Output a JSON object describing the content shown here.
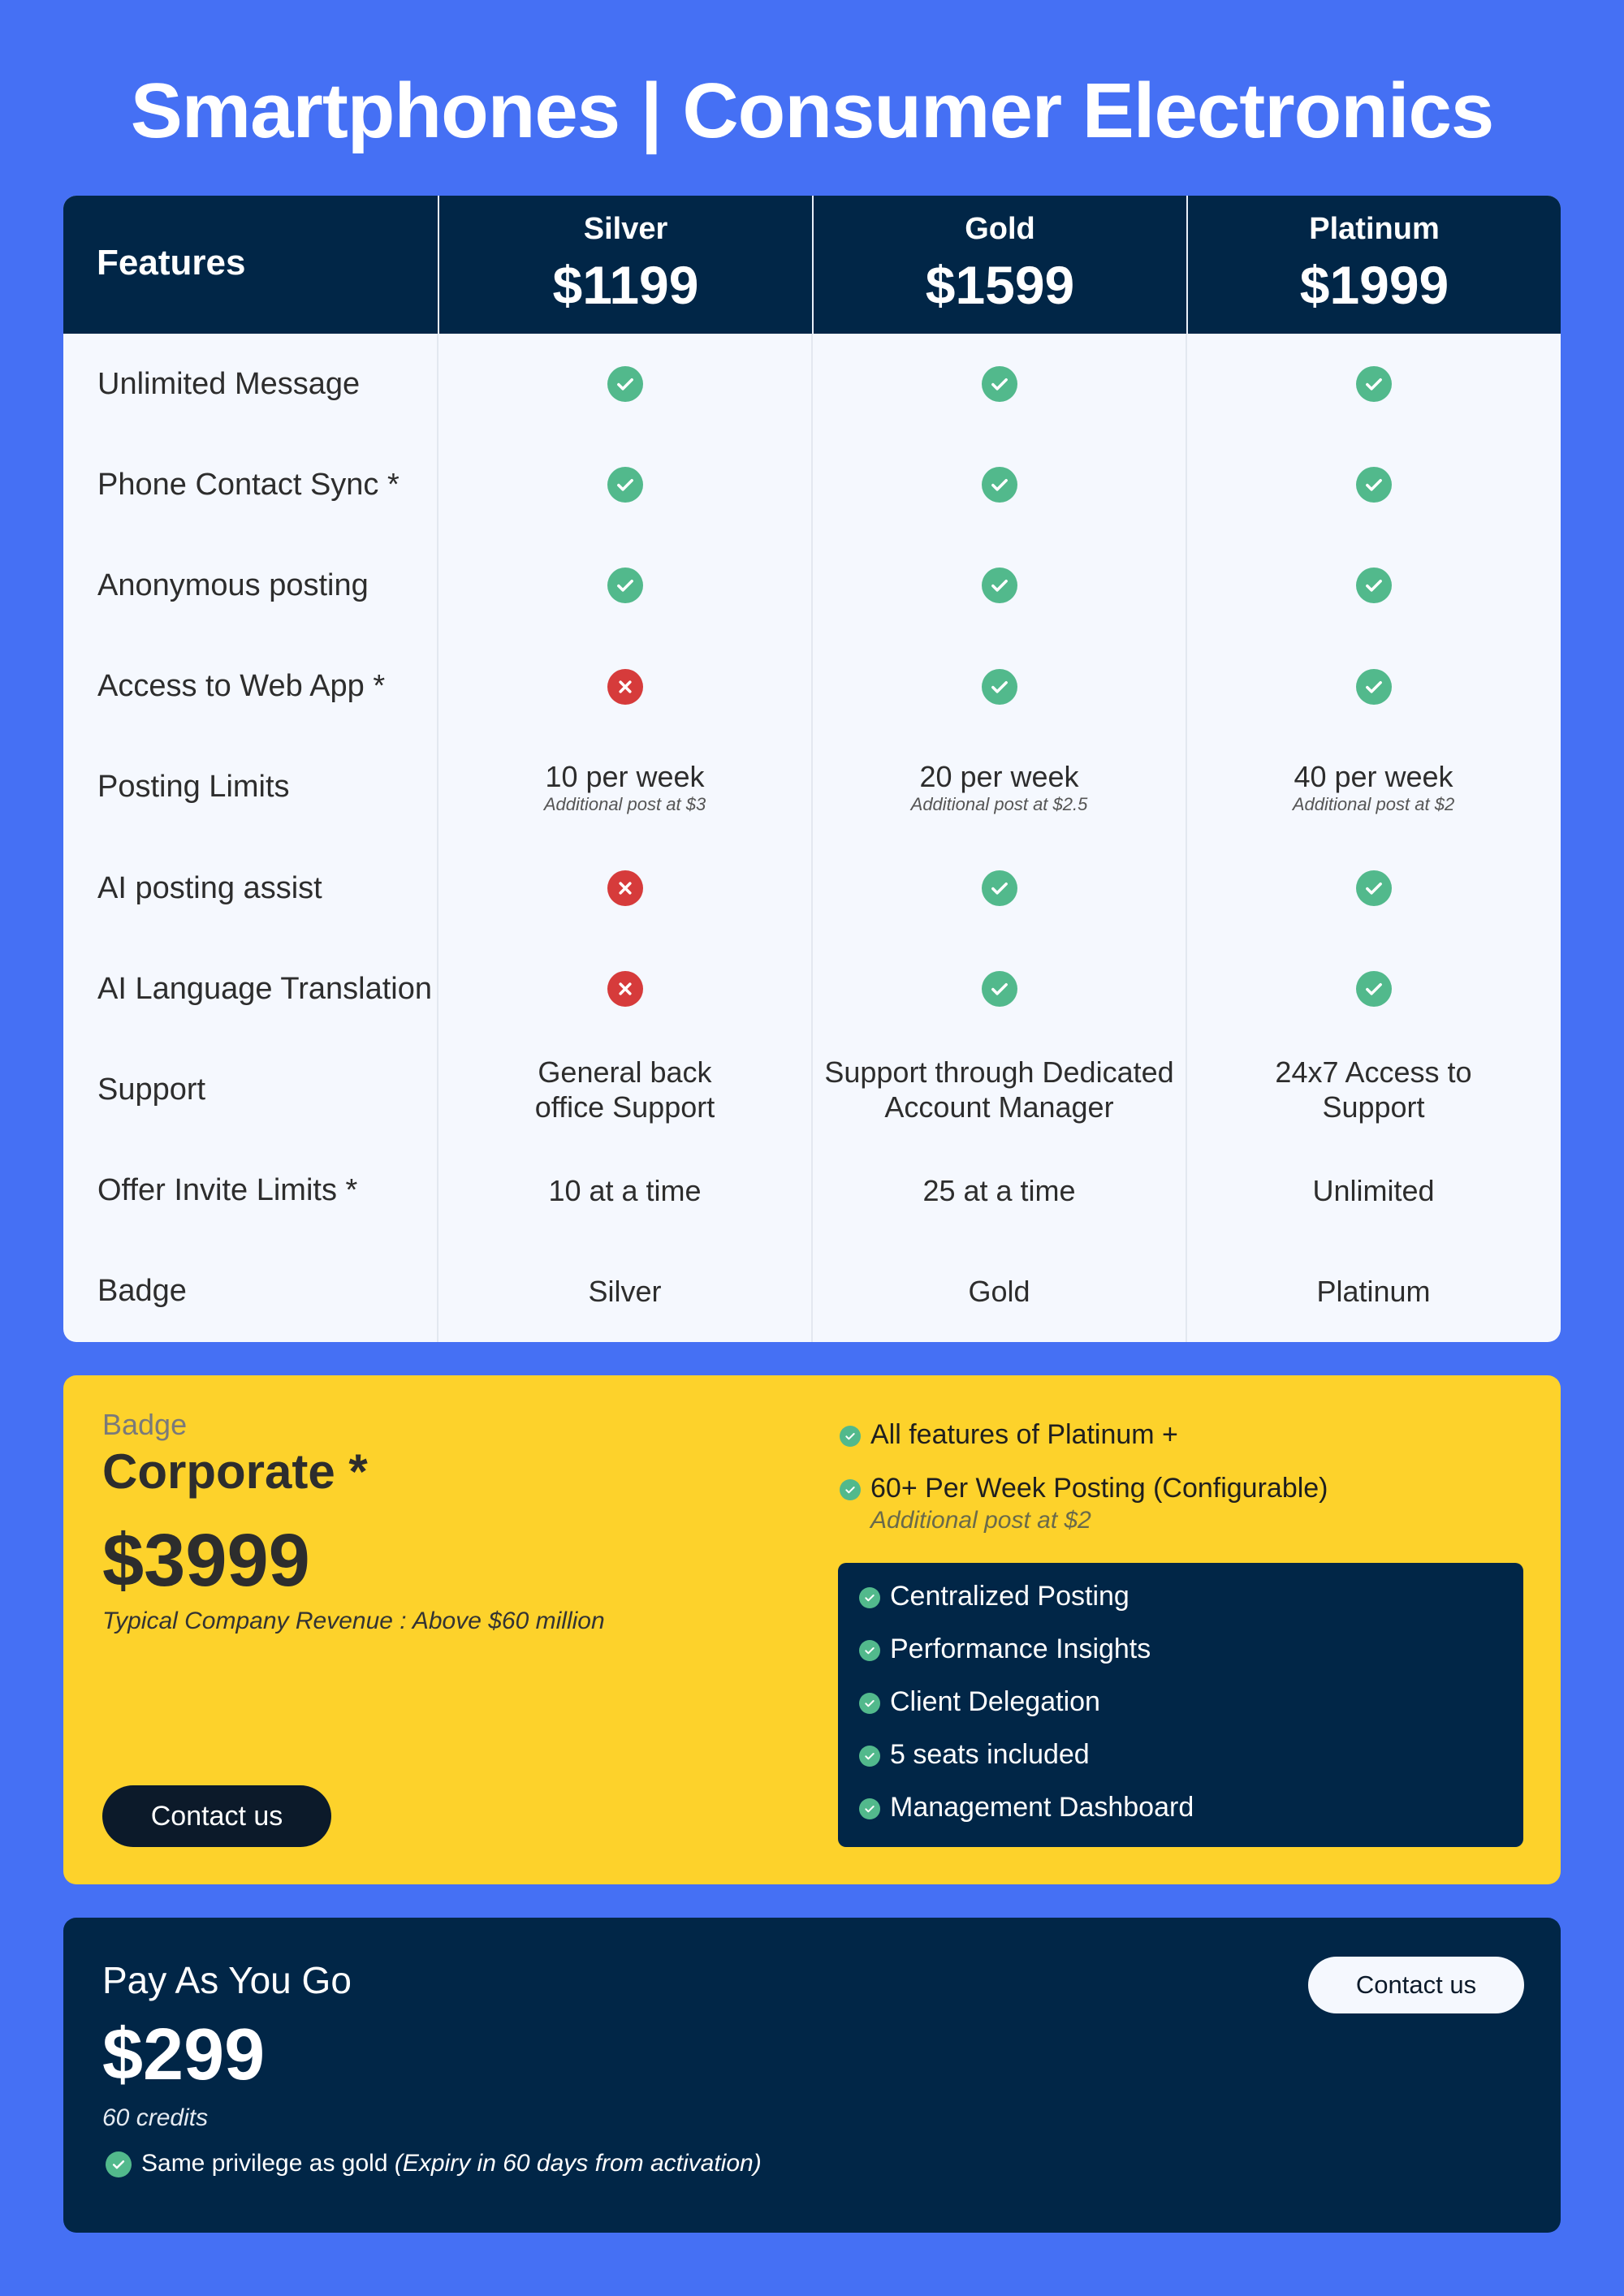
{
  "title": "Smartphones | Consumer Electronics",
  "colors": {
    "background": "#4570f4",
    "header": "#012647",
    "check": "#52b98c",
    "cross": "#d63b3b",
    "corporate_card": "#fdd22b"
  },
  "table": {
    "features_header": "Features",
    "plans": [
      {
        "name": "Silver",
        "price": "$1199"
      },
      {
        "name": "Gold",
        "price": "$1599"
      },
      {
        "name": "Platinum",
        "price": "$1999"
      }
    ],
    "rows": [
      {
        "feature": "Unlimited Message",
        "values": [
          {
            "type": "check"
          },
          {
            "type": "check"
          },
          {
            "type": "check"
          }
        ]
      },
      {
        "feature": "Phone Contact Sync *",
        "values": [
          {
            "type": "check"
          },
          {
            "type": "check"
          },
          {
            "type": "check"
          }
        ]
      },
      {
        "feature": "Anonymous posting",
        "values": [
          {
            "type": "check"
          },
          {
            "type": "check"
          },
          {
            "type": "check"
          }
        ]
      },
      {
        "feature": "Access to Web App *",
        "values": [
          {
            "type": "cross"
          },
          {
            "type": "check"
          },
          {
            "type": "check"
          }
        ]
      },
      {
        "feature": "Posting Limits",
        "values": [
          {
            "type": "text",
            "text": "10 per week",
            "sub": "Additional post at $3"
          },
          {
            "type": "text",
            "text": "20 per week",
            "sub": "Additional post at $2.5"
          },
          {
            "type": "text",
            "text": "40 per week",
            "sub": "Additional post at $2"
          }
        ]
      },
      {
        "feature": "AI posting assist",
        "values": [
          {
            "type": "cross"
          },
          {
            "type": "check"
          },
          {
            "type": "check"
          }
        ]
      },
      {
        "feature": "AI Language Translation",
        "values": [
          {
            "type": "cross"
          },
          {
            "type": "check"
          },
          {
            "type": "check"
          }
        ]
      },
      {
        "feature": "Support",
        "values": [
          {
            "type": "text",
            "lines": [
              "General back",
              "office Support"
            ]
          },
          {
            "type": "text",
            "lines": [
              "Support through Dedicated",
              "Account Manager"
            ]
          },
          {
            "type": "text",
            "lines": [
              "24x7 Access to",
              "Support"
            ]
          }
        ]
      },
      {
        "feature": "Offer Invite Limits  *",
        "values": [
          {
            "type": "text",
            "text": "10 at a time"
          },
          {
            "type": "text",
            "text": "25 at a time"
          },
          {
            "type": "text",
            "text": "Unlimited"
          }
        ]
      },
      {
        "feature": "Badge",
        "values": [
          {
            "type": "text",
            "text": "Silver"
          },
          {
            "type": "text",
            "text": "Gold"
          },
          {
            "type": "text",
            "text": "Platinum"
          }
        ]
      }
    ]
  },
  "corporate": {
    "badge_label": "Badge",
    "name": "Corporate *",
    "price": "$3999",
    "note": "Typical Company Revenue : Above $60 million",
    "button": "Contact us",
    "features": [
      {
        "text": "All features of Platinum +"
      },
      {
        "text": "60+ Per Week Posting (Configurable)",
        "sub": "Additional post at $2"
      }
    ],
    "extras": [
      "Centralized Posting",
      "Performance Insights",
      "Client Delegation",
      "5 seats included",
      "Management Dashboard"
    ]
  },
  "payg": {
    "name": "Pay As You Go",
    "price": "$299",
    "credits": "60 credits",
    "feature": "Same privilege as gold",
    "feature_note": "(Expiry in 60 days from activation)",
    "button": "Contact us"
  }
}
